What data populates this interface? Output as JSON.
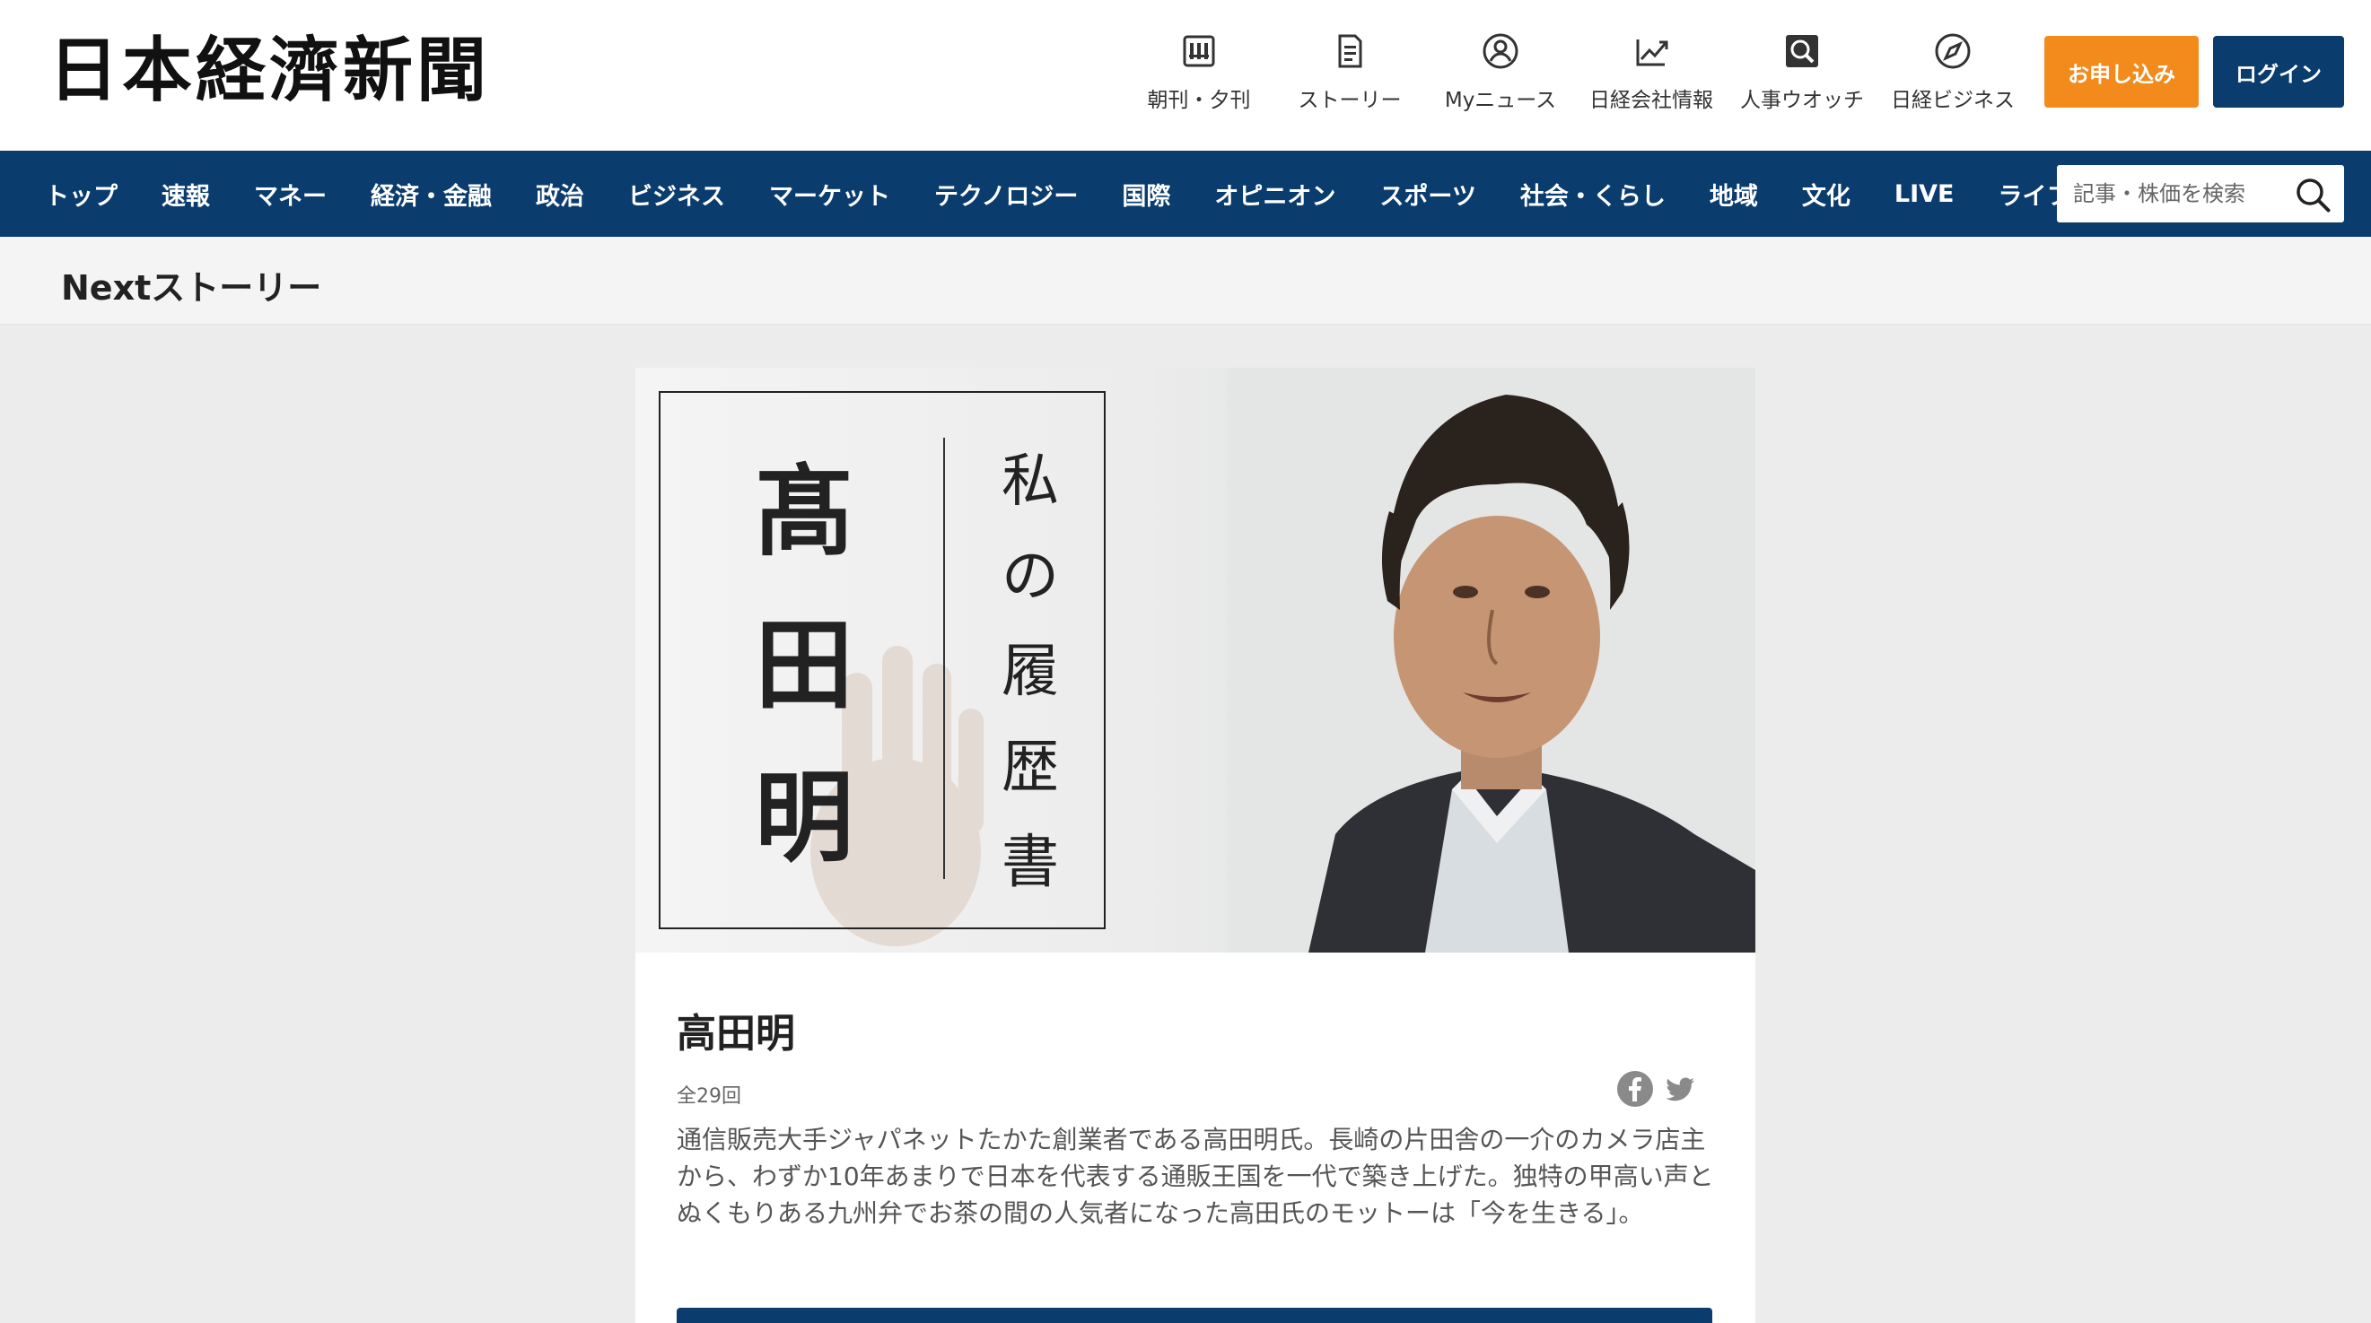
{
  "header": {
    "logo_text": "日本経濟新聞",
    "util_nav": [
      {
        "label": "朝刊・夕刊",
        "icon": "newspaper-icon"
      },
      {
        "label": "ストーリー",
        "icon": "document-icon"
      },
      {
        "label": "Myニュース",
        "icon": "user-circle-icon"
      },
      {
        "label": "日経会社情報",
        "icon": "chart-line-icon"
      },
      {
        "label": "人事ウオッチ",
        "icon": "search-box-icon"
      },
      {
        "label": "日経ビジネス",
        "icon": "compass-icon"
      }
    ],
    "apply_label": "お申し込み",
    "login_label": "ログイン"
  },
  "nav": {
    "items": [
      "トップ",
      "速報",
      "マネー",
      "経済・金融",
      "政治",
      "ビジネス",
      "マーケット",
      "テクノロジー",
      "国際",
      "オピニオン",
      "スポーツ",
      "社会・くらし",
      "地域",
      "文化",
      "LIVE",
      "ライフ"
    ],
    "search_placeholder": "記事・株価を検索"
  },
  "section": {
    "title": "Nextストーリー"
  },
  "card": {
    "hero": {
      "name_vertical": "髙田明",
      "series_vertical": "私の履歴書"
    },
    "title": "高田明",
    "episode_count": "全29回",
    "description": "通信販売大手ジャパネットたかた創業者である高田明氏。長崎の片田舎の一介のカメラ店主から、わずか10年あまりで日本を代表する通販王国を一代で築き上げた。独特の甲高い声とぬくもりある九州弁でお茶の間の人気者になった高田氏のモットーは「今を生きる」。",
    "share": [
      "facebook-icon",
      "twitter-icon"
    ]
  },
  "colors": {
    "brand_navy": "#0a3c6e",
    "apply_orange": "#f28b1b",
    "page_bg": "#ececec"
  }
}
